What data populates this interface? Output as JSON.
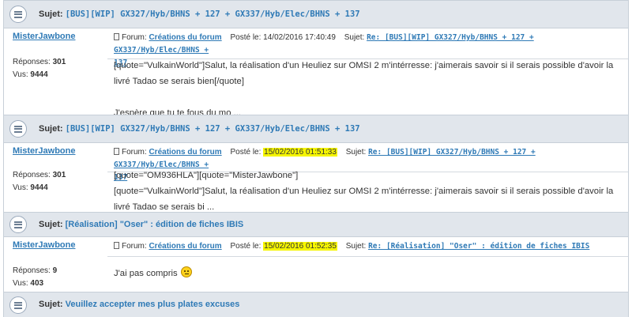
{
  "labels": {
    "subject": "Sujet:",
    "forum": "Forum:",
    "posted": "Posté le:",
    "replies": "Réponses:",
    "views": "Vus:"
  },
  "topics": [
    {
      "subject": "[BUS][WIP] GX327/Hyb/BHNS + 127 + GX337/Hyb/Elec/BHNS + 137",
      "author": "MisterJawbone",
      "replies": "301",
      "views": "9444",
      "forum": "Créations du forum",
      "date": "14/02/2016 17:40:49",
      "reply_subject_line1": "Re: [BUS][WIP] GX327/Hyb/BHNS + 127 + GX337/Hyb/Elec/BHNS +",
      "reply_subject_line2": "137",
      "body_lines": [
        "[quote=\"VulkainWorld\"]Salut, la réalisation d'un Heuliez sur OMSI 2 m'intérresse: j'aimerais savoir si il serais possible d'avoir la",
        "livré Tadao se serais bien[/quote]",
        "",
        "J'espère que tu te fous du mo ..."
      ]
    },
    {
      "subject": "[BUS][WIP] GX327/Hyb/BHNS + 127 + GX337/Hyb/Elec/BHNS + 137",
      "author": "MisterJawbone",
      "replies": "301",
      "views": "9444",
      "forum": "Créations du forum",
      "date": "15/02/2016 01:51:33",
      "reply_subject_line1": "Re: [BUS][WIP] GX327/Hyb/BHNS + 127 + GX337/Hyb/Elec/BHNS +",
      "reply_subject_line2": "137",
      "body_lines": [
        "[quote=\"OM936HLA\"][quote=\"MisterJawbone\"]",
        "[quote=\"VulkainWorld\"]Salut, la réalisation d'un Heuliez sur OMSI 2 m'intérresse: j'aimerais savoir si il serais possible d'avoir la",
        "livré Tadao se serais bi ..."
      ]
    },
    {
      "subject": "[Réalisation] \"Oser\" : édition de fiches IBIS",
      "author": "MisterJawbone",
      "replies": "9",
      "views": "403",
      "forum": "Créations du forum",
      "date": "15/02/2016 01:52:35",
      "reply_subject_line1": "Re: [Réalisation] \"Oser\" : édition de fiches IBIS",
      "body_lines": [
        "J'ai pas compris"
      ]
    },
    {
      "subject": "Veuillez accepter mes plus plates excuses"
    }
  ]
}
